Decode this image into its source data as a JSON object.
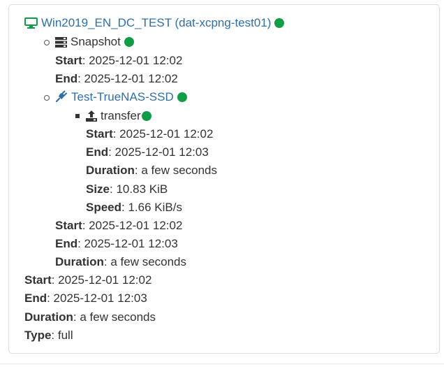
{
  "vm": {
    "label": "Win2019_EN_DC_TEST (dat-xcpng-test01)",
    "icon": "desktop-icon",
    "status_color": "#109d47"
  },
  "snapshot": {
    "label": "Snapshot",
    "icon": "server-icon",
    "start_label": "Start",
    "start_value": ": 2025-12-01 12:02",
    "end_label": "End",
    "end_value": ": 2025-12-01 12:02"
  },
  "remote": {
    "label": "Test-TrueNAS-SSD",
    "icon": "plug-icon",
    "transfer": {
      "label": "transfer",
      "icon": "upload-icon",
      "start_label": "Start",
      "start_value": ": 2025-12-01 12:02",
      "end_label": "End",
      "end_value": ": 2025-12-01 12:03",
      "duration_label": "Duration",
      "duration_value": ": a few seconds",
      "size_label": "Size",
      "size_value": ": 10.83 KiB",
      "speed_label": "Speed",
      "speed_value": ": 1.66 KiB/s"
    },
    "start_label": "Start",
    "start_value": ": 2025-12-01 12:02",
    "end_label": "End",
    "end_value": ": 2025-12-01 12:03",
    "duration_label": "Duration",
    "duration_value": ": a few seconds"
  },
  "summary": {
    "start_label": "Start",
    "start_value": ": 2025-12-01 12:02",
    "end_label": "End",
    "end_value": ": 2025-12-01 12:03",
    "duration_label": "Duration",
    "duration_value": ": a few seconds",
    "type_label": "Type",
    "type_value": ": full"
  }
}
